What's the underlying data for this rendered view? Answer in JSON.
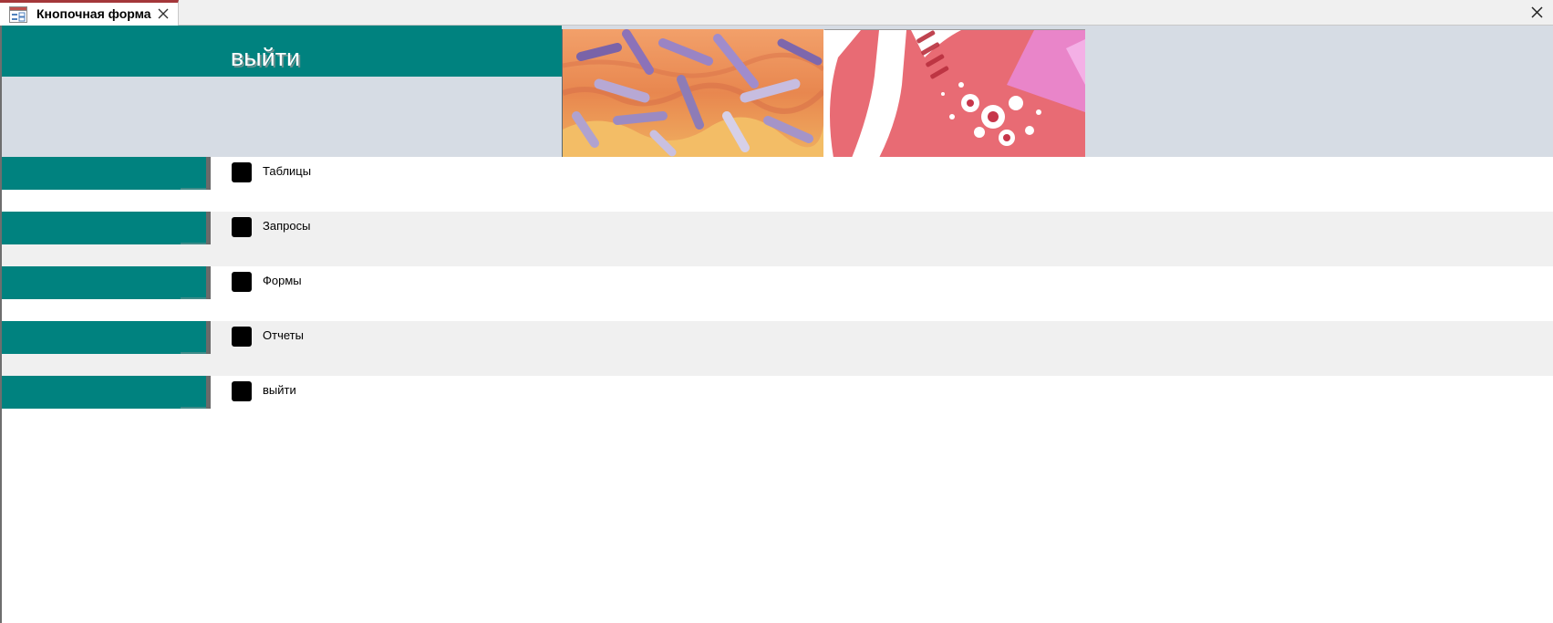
{
  "tab": {
    "title": "Кнопочная форма",
    "icon": "form-icon",
    "accent_color": "#a4373a"
  },
  "header": {
    "title": "выйти",
    "band_color": "#00827f",
    "background_color": "#d6dce4",
    "images": [
      "bacteria-illustration",
      "lung-illustration"
    ]
  },
  "menu": {
    "items": [
      {
        "label": "Таблицы"
      },
      {
        "label": "Запросы"
      },
      {
        "label": "Формы"
      },
      {
        "label": "Отчеты"
      },
      {
        "label": "выйти"
      }
    ]
  }
}
